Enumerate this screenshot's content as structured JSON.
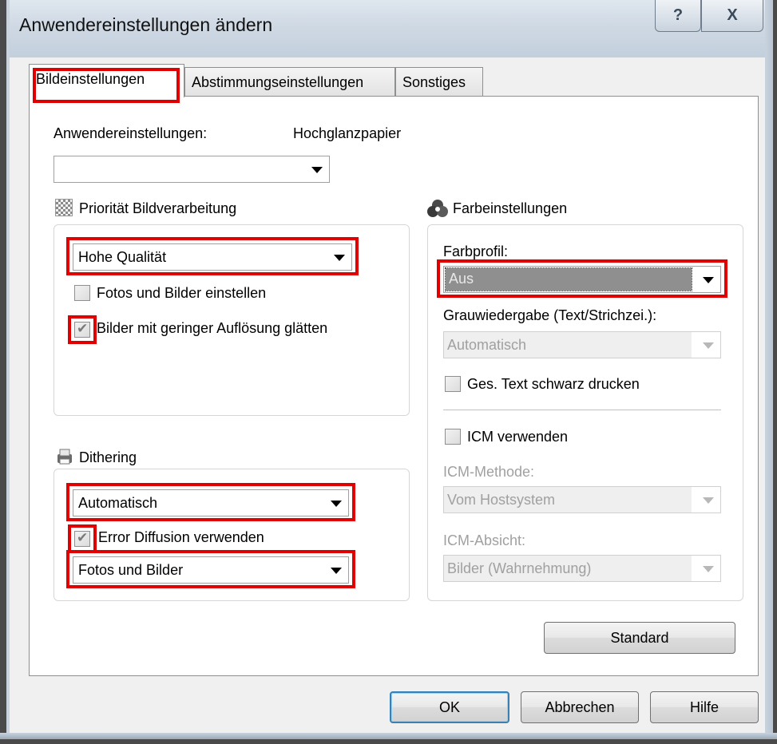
{
  "window": {
    "title": "Anwendereinstellungen ändern",
    "help_glyph": "?",
    "close_glyph": "X"
  },
  "tabs": [
    {
      "label": "Bildeinstellungen"
    },
    {
      "label": "Abstimmungseinstellungen"
    },
    {
      "label": "Sonstiges"
    }
  ],
  "user_settings": {
    "label": "Anwendereinstellungen:",
    "value_text": "Hochglanzpapier",
    "combo_value": ""
  },
  "image_priority": {
    "heading": "Priorität Bildverarbeitung",
    "icon": "checker-pattern-icon",
    "combo_value": "Hohe Qualität",
    "photos_checkbox": {
      "label": "Fotos und Bilder einstellen",
      "checked": false
    },
    "smooth_checkbox": {
      "label": "Bilder mit geringer Auflösung glätten",
      "checked": true
    }
  },
  "dithering": {
    "heading": "Dithering",
    "icon": "printer-icon",
    "combo_value": "Automatisch",
    "error_diffusion": {
      "label": "Error Diffusion verwenden",
      "checked": true
    },
    "mode_value": "Fotos und Bilder"
  },
  "color_settings": {
    "heading": "Farbeinstellungen",
    "icon": "color-drops-icon",
    "profile_label": "Farbprofil:",
    "profile_value": "Aus",
    "gray_label": "Grauwiedergabe (Text/Strichzei.):",
    "gray_value": "Automatisch",
    "black_text": {
      "label": "Ges. Text schwarz drucken",
      "checked": false
    },
    "icm": {
      "label": "ICM verwenden",
      "checked": false
    },
    "icm_method_label": "ICM-Methode:",
    "icm_method_value": "Vom Hostsystem",
    "icm_intent_label": "ICM-Absicht:",
    "icm_intent_value": "Bilder (Wahrnehmung)"
  },
  "buttons": {
    "standard": "Standard",
    "ok": "OK",
    "cancel": "Abbrechen",
    "help": "Hilfe"
  },
  "colors": {
    "highlight": "#e00000",
    "selection": "#8f8f8f"
  }
}
